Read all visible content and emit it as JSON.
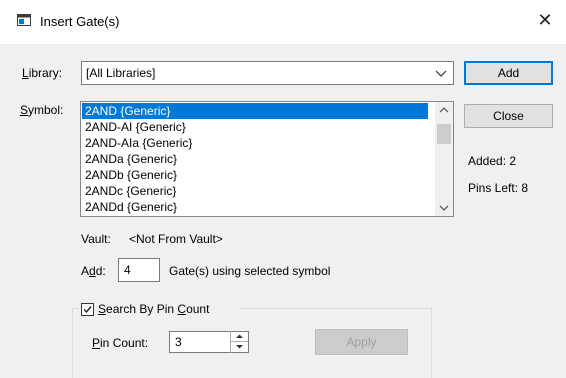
{
  "window": {
    "title": "Insert Gate(s)",
    "close_glyph": "✕"
  },
  "library": {
    "label_ul": "L",
    "label_rest": "ibrary:",
    "value": "[All Libraries]"
  },
  "symbol": {
    "label_ul": "S",
    "label_rest": "ymbol:",
    "items": [
      "2AND {Generic}",
      "2AND-AI {Generic}",
      "2AND-AIa {Generic}",
      "2ANDa {Generic}",
      "2ANDb {Generic}",
      "2ANDc {Generic}",
      "2ANDd {Generic}"
    ],
    "selected_index": 0
  },
  "buttons": {
    "add": "Add",
    "close": "Close",
    "apply": "Apply"
  },
  "stats": {
    "added": "Added:  2",
    "pins_left": "Pins Left: 8"
  },
  "vault": {
    "label": "Vault:",
    "value": "<Not From Vault>"
  },
  "add_count": {
    "label_pre": "A",
    "label_ul": "d",
    "label_post": "d:",
    "value": "4",
    "suffix": "Gate(s) using selected symbol"
  },
  "search": {
    "checked": true,
    "label_ul": "S",
    "label_mid": "earch By Pin ",
    "label_ul2": "C",
    "label_end": "ount"
  },
  "pin_count": {
    "label_ul": "P",
    "label_rest": "in Count:",
    "value": "3"
  },
  "colors": {
    "accent": "#0078d7",
    "dialog_bg": "#f0f0f0"
  },
  "icons": {
    "window": "window-icon",
    "combo_arrow": "chevron-down-icon",
    "check": "check-icon"
  }
}
